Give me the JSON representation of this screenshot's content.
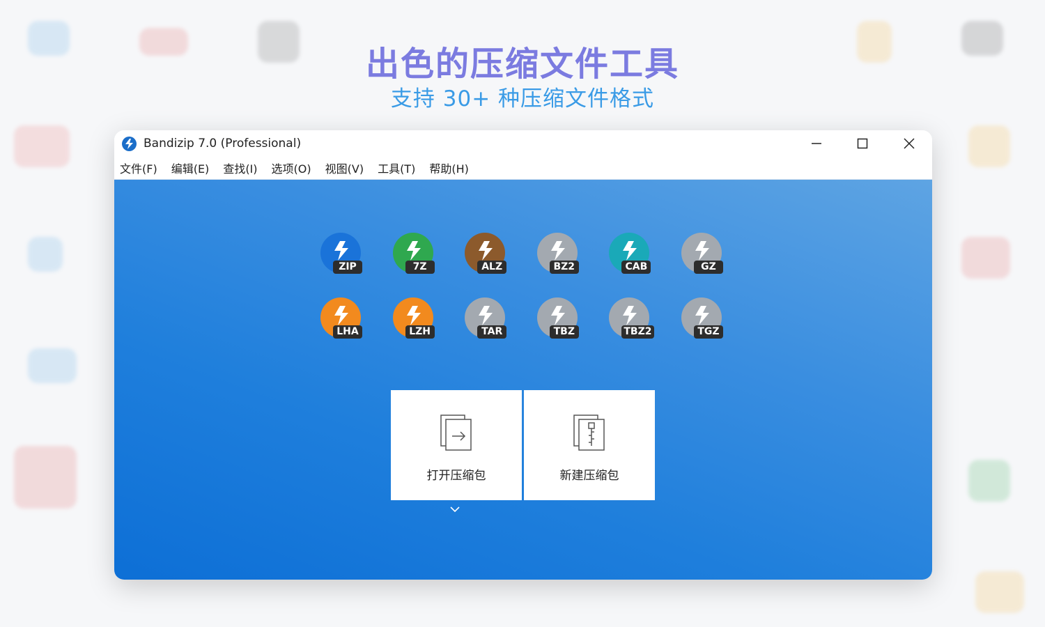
{
  "headline": "出色的压缩文件工具",
  "subline": "支持 30+ 种压缩文件格式",
  "window": {
    "title": "Bandizip 7.0 (Professional)",
    "controls": [
      "minimize-icon",
      "maximize-icon",
      "close-icon"
    ]
  },
  "menu": [
    "文件(F)",
    "编辑(E)",
    "查找(I)",
    "选项(O)",
    "视图(V)",
    "工具(T)",
    "帮助(H)"
  ],
  "formats": [
    {
      "label": "ZIP",
      "color": "#1a73d9"
    },
    {
      "label": "7Z",
      "color": "#2fa84f"
    },
    {
      "label": "ALZ",
      "color": "#8c5a2c"
    },
    {
      "label": "BZ2",
      "color": "#a3a9b0"
    },
    {
      "label": "CAB",
      "color": "#1aa9b8"
    },
    {
      "label": "GZ",
      "color": "#a3a9b0"
    },
    {
      "label": "LHA",
      "color": "#f28a1e"
    },
    {
      "label": "LZH",
      "color": "#f28a1e"
    },
    {
      "label": "TAR",
      "color": "#a3a9b0"
    },
    {
      "label": "TBZ",
      "color": "#a3a9b0"
    },
    {
      "label": "TBZ2",
      "color": "#a3a9b0"
    },
    {
      "label": "TGZ",
      "color": "#a3a9b0"
    }
  ],
  "actions": {
    "open_label": "打开压缩包",
    "new_label": "新建压缩包"
  },
  "colors": {
    "headline": "#7b7be0",
    "subline": "#3a9be6",
    "client_gradient_top": "#5ea4e3",
    "client_gradient_bottom": "#0d6fd6"
  }
}
